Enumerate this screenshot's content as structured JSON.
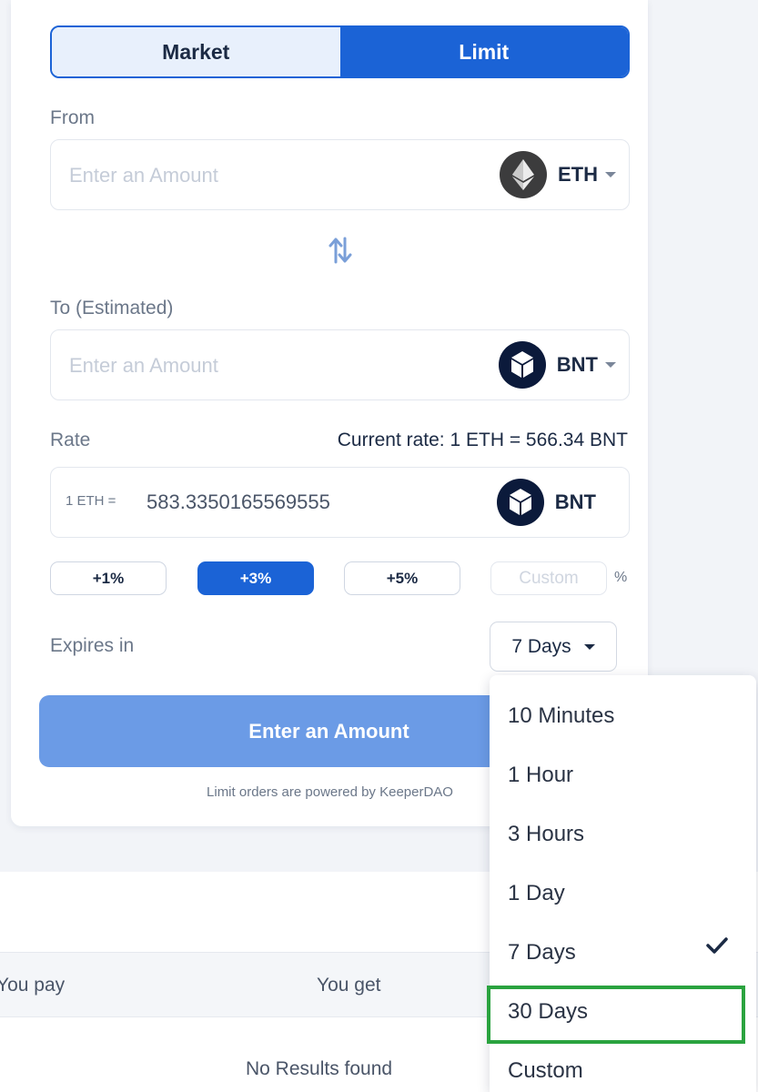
{
  "tabs": {
    "market": "Market",
    "limit": "Limit"
  },
  "from": {
    "label": "From",
    "placeholder": "Enter an Amount",
    "token": "ETH",
    "icon": "eth-icon"
  },
  "to": {
    "label": "To (Estimated)",
    "placeholder": "Enter an Amount",
    "token": "BNT",
    "icon": "bancor-icon"
  },
  "rate": {
    "label": "Rate",
    "current": "Current rate: 1 ETH = 566.34 BNT",
    "prefix": "1 ETH =",
    "value": "583.3350165569555",
    "token": "BNT"
  },
  "percent": {
    "opt1": "+1%",
    "opt3": "+3%",
    "opt5": "+5%",
    "custom_placeholder": "Custom",
    "sign": "%",
    "active": "+3%"
  },
  "expires": {
    "label": "Expires in",
    "selected": "7 Days"
  },
  "cta": "Enter an Amount",
  "powered_by": "Limit orders are powered by KeeperDAO",
  "table": {
    "col_pay": "You pay",
    "col_get": "You get",
    "empty": "No Results found"
  },
  "dropdown": {
    "items": [
      "10 Minutes",
      "1 Hour",
      "3 Hours",
      "1 Day",
      "7 Days",
      "30 Days",
      "Custom"
    ],
    "checked": "7 Days",
    "highlighted": "30 Days"
  },
  "colors": {
    "accent": "#1b63d6",
    "cta": "#6b9be6",
    "highlight": "#2aa33f"
  }
}
